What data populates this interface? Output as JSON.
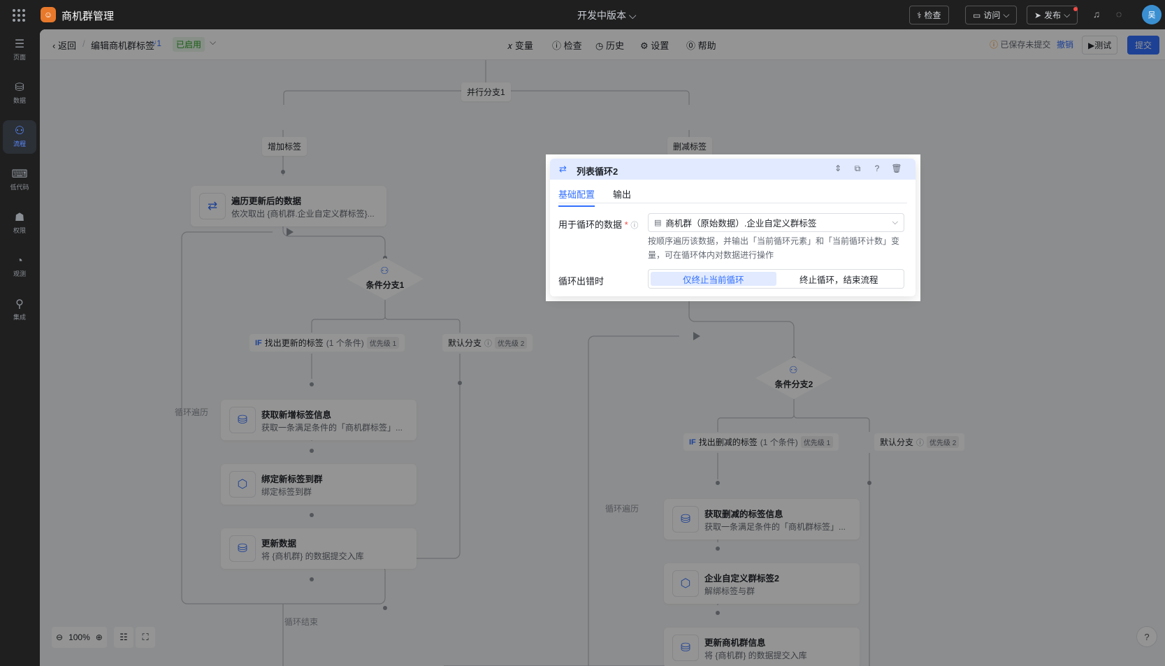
{
  "top": {
    "app_title": "商机群管理",
    "version": "开发中版本 ⌵",
    "check_label": "检查",
    "visit_label": "访问",
    "publish_label": "发布",
    "avatar_text": "吴"
  },
  "nav": [
    {
      "label": "页面",
      "icon": "☰"
    },
    {
      "label": "数据",
      "icon": "⛁"
    },
    {
      "label": "流程",
      "icon": "⚇"
    },
    {
      "label": "低代码",
      "icon": "⌨"
    },
    {
      "label": "权限",
      "icon": "☗"
    },
    {
      "label": "观测",
      "icon": "◔"
    },
    {
      "label": "集成",
      "icon": "⚲"
    }
  ],
  "toolbar": {
    "back": "返回",
    "breadcrumb": "编辑商机群标签",
    "version_count": "1",
    "status": "已启用",
    "variables": "变量",
    "check": "检查",
    "history": "历史",
    "settings": "设置",
    "help": "帮助",
    "saved_hint": "已保存未提交",
    "undo": "撤销",
    "test": "测试",
    "submit": "提交"
  },
  "flow": {
    "parallel": "并行分支1",
    "branch_add": "增加标签",
    "branch_remove": "删减标签",
    "loop1": {
      "title": "遍历更新后的数据",
      "desc": "依次取出 {商机群.企业自定义群标签}..."
    },
    "cond1": "条件分支1",
    "if1": {
      "if": "IF",
      "name": "找出更新的标签",
      "count": "(1 个条件)",
      "priority": "优先级 1"
    },
    "default1": {
      "name": "默认分支",
      "priority": "优先级 2"
    },
    "card_get_new": {
      "title": "获取新增标签信息",
      "desc": "获取一条满足条件的「商机群标签」..."
    },
    "card_bind": {
      "title": "绑定新标签到群",
      "desc": "绑定标签到群"
    },
    "card_update": {
      "title": "更新数据",
      "desc": "将 {商机群} 的数据提交入库"
    },
    "loop_traverse_1": "循环遍历",
    "loop_end": "循环结束",
    "cond2": "条件分支2",
    "if2": {
      "if": "IF",
      "name": "找出删减的标签",
      "count": "(1 个条件)",
      "priority": "优先级 1"
    },
    "default2": {
      "name": "默认分支",
      "priority": "优先级 2"
    },
    "card_get_removed": {
      "title": "获取删减的标签信息",
      "desc": "获取一条满足条件的「商机群标签」..."
    },
    "card_unbind": {
      "title": "企业自定义群标签2",
      "desc": "解绑标签与群"
    },
    "card_update_group": {
      "title": "更新商机群信息",
      "desc": "将 {商机群} 的数据提交入库"
    },
    "loop_traverse_2": "循环遍历"
  },
  "zoom": {
    "level": "100%"
  },
  "dialog": {
    "title": "列表循环2",
    "tabs": [
      "基础配置",
      "输出"
    ],
    "data_label": "用于循环的数据",
    "required_mark": "*",
    "data_value": "商机群（原始数据）.企业自定义群标签",
    "hint": "按顺序遍历该数据，并输出「当前循环元素」和「当前循环计数」变量，可在循环体内对数据进行操作",
    "error_label": "循环出错时",
    "error_options": [
      "仅终止当前循环",
      "终止循环，结束流程"
    ],
    "error_selected": 0
  }
}
